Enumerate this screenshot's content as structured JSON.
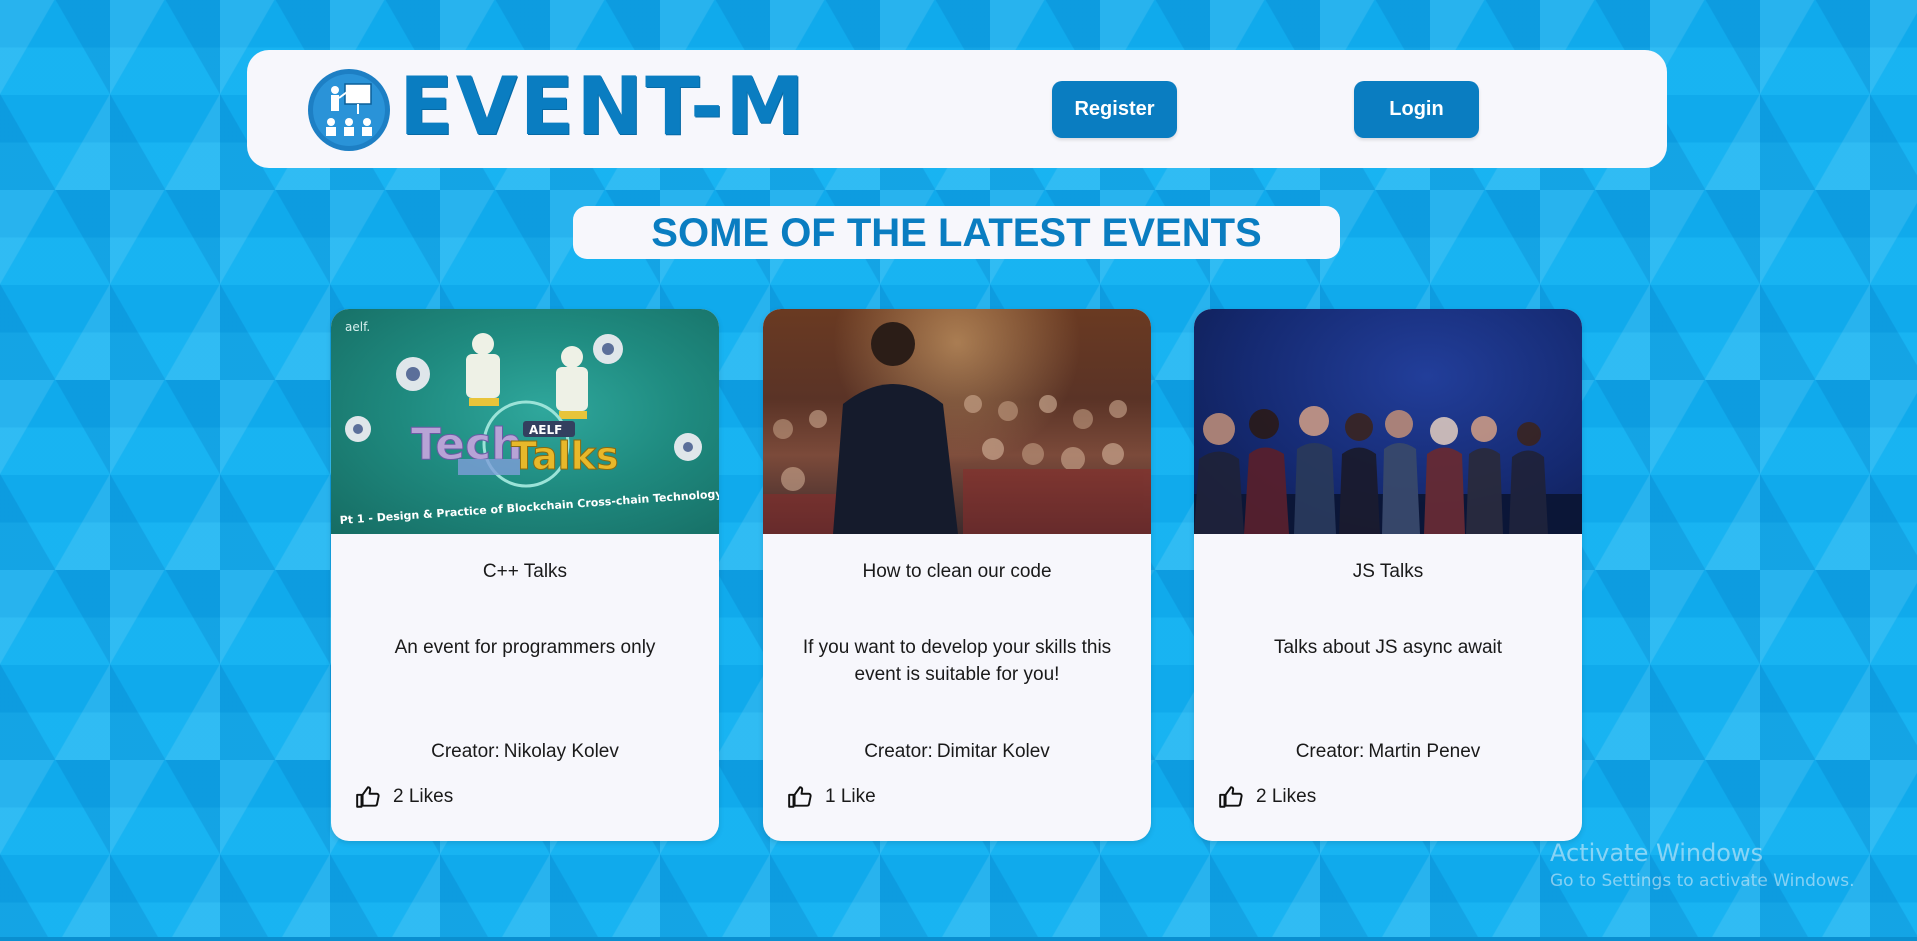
{
  "header": {
    "brand": "EVENT-M",
    "logo_icon": "presenter-audience-icon",
    "register_label": "Register",
    "login_label": "Login"
  },
  "section": {
    "title": "SOME OF THE LATEST EVENTS"
  },
  "events": [
    {
      "title": "C++ Talks",
      "description": "An event for programmers only",
      "creator_label": "Creator:",
      "creator": "Nikolay Kolev",
      "likes": "2 Likes",
      "image_caption": "Pt 1 - Design & Practice of Blockchain Cross-chain Technology",
      "image_text_main": "Tech",
      "image_text_secondary": "Talks",
      "image_badge": "AELF",
      "image_corner": "aelf."
    },
    {
      "title": "How to clean our code",
      "description": "If you want to develop your skills this event is suitable for you!",
      "creator_label": "Creator:",
      "creator": "Dimitar Kolev",
      "likes": "1 Like"
    },
    {
      "title": "JS Talks",
      "description": "Talks about JS async await",
      "creator_label": "Creator:",
      "creator": "Martin Penev",
      "likes": "2 Likes"
    }
  ],
  "watermark": {
    "title": "Activate Windows",
    "subtitle": "Go to Settings to activate Windows."
  },
  "colors": {
    "accent": "#0a7dc1",
    "background": "#12b0f0",
    "card": "#f7f7fc"
  }
}
